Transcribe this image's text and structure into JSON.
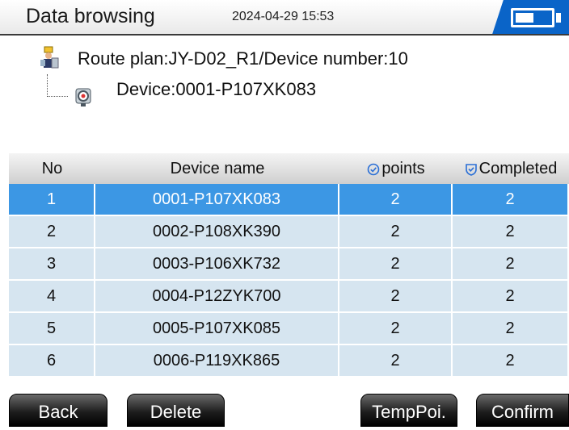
{
  "header": {
    "title": "Data browsing",
    "datetime": "2024-04-29 15:53",
    "battery_icon": "battery-icon",
    "accent_color": "#0a64c8"
  },
  "route": {
    "plan_text": "Route plan:JY-D02_R1/Device number:10",
    "device_text": "Device:0001-P107XK083"
  },
  "table": {
    "columns": [
      "No",
      "Device name",
      "points",
      "Completed"
    ],
    "selected_index": 0,
    "rows": [
      {
        "no": "1",
        "name": "0001-P107XK083",
        "points": "2",
        "completed": "2"
      },
      {
        "no": "2",
        "name": "0002-P108XK390",
        "points": "2",
        "completed": "2"
      },
      {
        "no": "3",
        "name": "0003-P106XK732",
        "points": "2",
        "completed": "2"
      },
      {
        "no": "4",
        "name": "0004-P12ZYK700",
        "points": "2",
        "completed": "2"
      },
      {
        "no": "5",
        "name": "0005-P107XK085",
        "points": "2",
        "completed": "2"
      },
      {
        "no": "6",
        "name": "0006-P119XK865",
        "points": "2",
        "completed": "2"
      }
    ]
  },
  "buttons": {
    "back": "Back",
    "delete": "Delete",
    "temp": "TempPoi.",
    "confirm": "Confirm"
  },
  "colors": {
    "selected_row": "#3c97e4",
    "row_bg": "#d6e5f0"
  }
}
